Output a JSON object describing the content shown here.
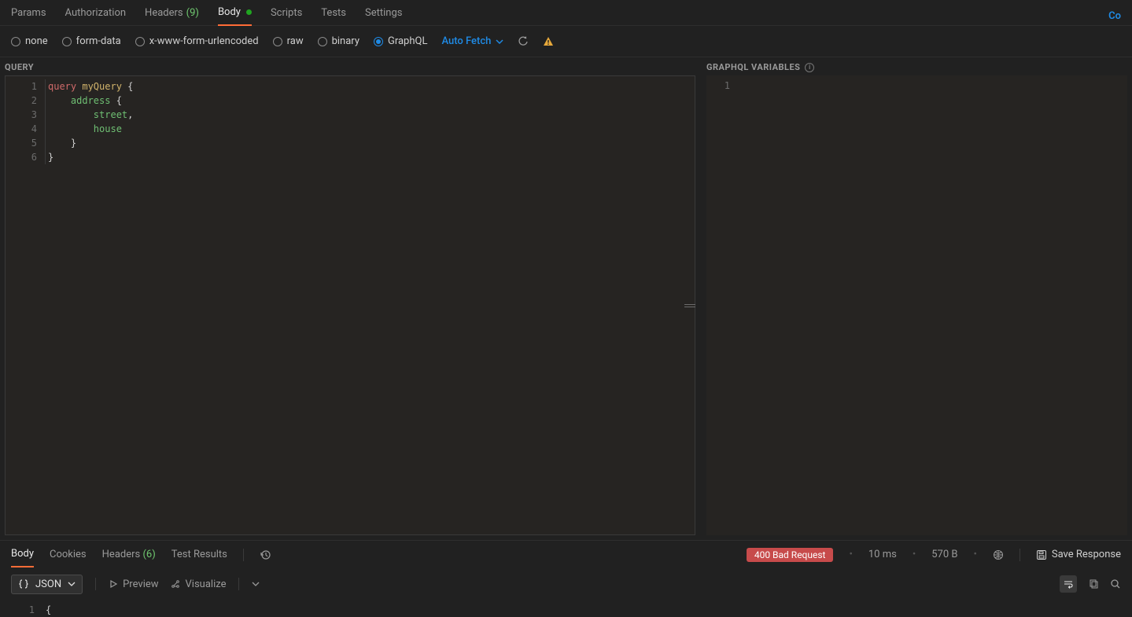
{
  "topLink": "Co",
  "reqTabs": {
    "params": "Params",
    "authorization": "Authorization",
    "headers": "Headers",
    "headersCount": "(9)",
    "body": "Body",
    "scripts": "Scripts",
    "tests": "Tests",
    "settings": "Settings"
  },
  "bodyTypes": {
    "none": "none",
    "formData": "form-data",
    "xwww": "x-www-form-urlencoded",
    "raw": "raw",
    "binary": "binary",
    "graphql": "GraphQL",
    "autoFetch": "Auto Fetch"
  },
  "panes": {
    "queryHdr": "QUERY",
    "varsHdr": "GRAPHQL VARIABLES"
  },
  "queryLines": {
    "l1_kw": "query",
    "l1_name": " myQuery ",
    "l1_brace": "{",
    "l2_indent": "    ",
    "l2_field": "address",
    "l2_brace": " {",
    "l3_indent": "        ",
    "l3_field": "street",
    "l3_tail": ",",
    "l4_indent": "        ",
    "l4_field": "house",
    "l5_indent": "    ",
    "l5_brace": "}",
    "l6_brace": "}"
  },
  "queryGutter": [
    "1",
    "2",
    "3",
    "4",
    "5",
    "6"
  ],
  "varsGutter": [
    "1"
  ],
  "respTabs": {
    "body": "Body",
    "cookies": "Cookies",
    "headers": "Headers",
    "headersCount": "(6)",
    "testResults": "Test Results"
  },
  "respMeta": {
    "status": "400 Bad Request",
    "time": "10 ms",
    "size": "570 B",
    "save": "Save Response"
  },
  "viewRow": {
    "json": "JSON",
    "preview": "Preview",
    "visualize": "Visualize"
  },
  "respEditor": {
    "gutter1": "1",
    "line1": "{"
  }
}
